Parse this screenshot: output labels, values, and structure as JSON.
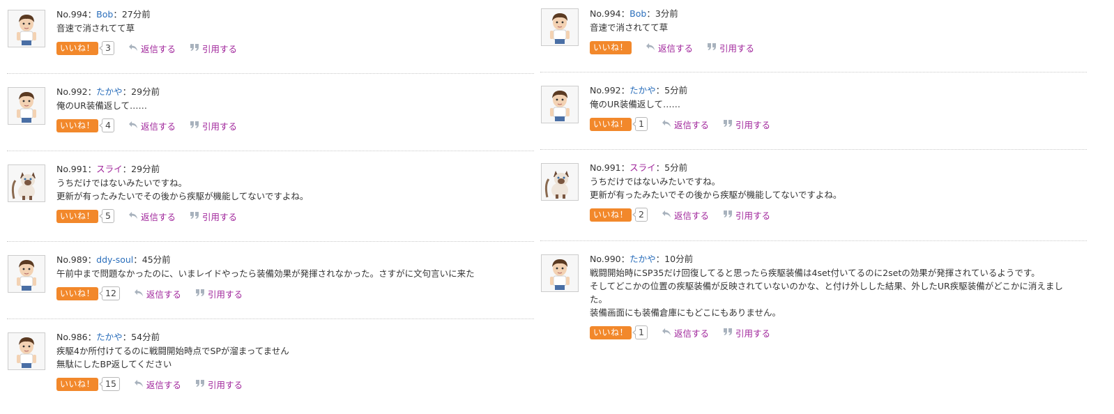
{
  "labels": {
    "like": "いいね！",
    "reply": "返信する",
    "quote": "引用する"
  },
  "left_posts": [
    {
      "no": "No.994",
      "sep": "：",
      "name": "Bob",
      "time": "27分前",
      "avatar": "boy",
      "name_color": "blue",
      "lines": [
        "音速で消されてて草"
      ],
      "likes": "3"
    },
    {
      "no": "No.992",
      "sep": "：",
      "name": "たかや",
      "time": "29分前",
      "avatar": "boy",
      "name_color": "blue",
      "lines": [
        "俺のUR装備返して……"
      ],
      "likes": "4"
    },
    {
      "no": "No.991",
      "sep": "：",
      "name": "スライ",
      "time": "29分前",
      "avatar": "cat",
      "name_color": "purple",
      "lines": [
        "うちだけではないみたいですね。",
        "更新が有ったみたいでその後から疾駆が機能してないですよね。"
      ],
      "likes": "5"
    },
    {
      "no": "No.989",
      "sep": "：",
      "name": "ddy-soul",
      "time": "45分前",
      "avatar": "boy",
      "name_color": "blue",
      "lines": [
        "午前中まで問題なかったのに、いまレイドやったら装備効果が発揮されなかった。さすがに文句言いに来た"
      ],
      "likes": "12"
    },
    {
      "no": "No.986",
      "sep": "：",
      "name": "たかや",
      "time": "54分前",
      "avatar": "boy",
      "name_color": "blue",
      "lines": [
        "疾駆4か所付けてるのに戦闘開始時点でSPが溜まってません",
        "無駄にしたBP返してください"
      ],
      "likes": "15"
    }
  ],
  "right_posts": [
    {
      "no": "No.994",
      "sep": "：",
      "name": "Bob",
      "time": "3分前",
      "avatar": "boy",
      "name_color": "blue",
      "lines": [
        "音速で消されてて草"
      ],
      "likes": ""
    },
    {
      "no": "No.992",
      "sep": "：",
      "name": "たかや",
      "time": "5分前",
      "avatar": "boy",
      "name_color": "blue",
      "lines": [
        "俺のUR装備返して……"
      ],
      "likes": "1"
    },
    {
      "no": "No.991",
      "sep": "：",
      "name": "スライ",
      "time": "5分前",
      "avatar": "cat",
      "name_color": "purple",
      "lines": [
        "うちだけではないみたいですね。",
        "更新が有ったみたいでその後から疾駆が機能してないですよね。"
      ],
      "likes": "2"
    },
    {
      "no": "No.990",
      "sep": "：",
      "name": "たかや",
      "time": "10分前",
      "avatar": "boy",
      "name_color": "blue",
      "lines": [
        "戦闘開始時にSP35だけ回復してると思ったら疾駆装備は4set付いてるのに2setの効果が発揮されているようです。",
        "そしてどこかの位置の疾駆装備が反映されていないのかな、と付け外しした結果、外したUR疾駆装備がどこかに消えまし",
        "た。",
        "装備画面にも装備倉庫にもどこにもありません。"
      ],
      "likes": "1"
    }
  ]
}
